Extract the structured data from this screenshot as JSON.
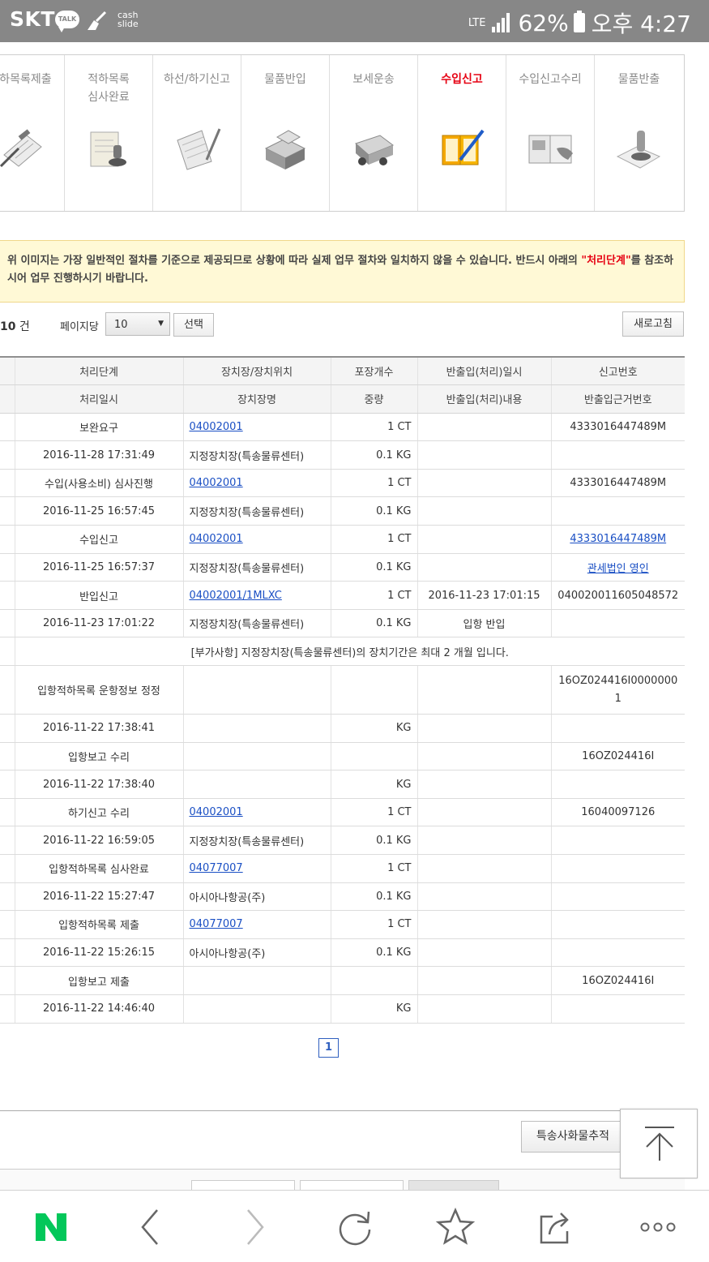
{
  "status_bar": {
    "carrier": "SKT",
    "talk_badge": "TALK",
    "cash_line1": "cash",
    "cash_line2": "slide",
    "lte": "LTE",
    "battery": "62%",
    "time": "오후 4:27"
  },
  "steps": [
    {
      "label": "적하목록제출",
      "icon": "clipboard-pen-icon",
      "active": false
    },
    {
      "label": "적하목록 심사완료",
      "icon": "document-stamp-icon",
      "active": false
    },
    {
      "label": "하선/하기신고",
      "icon": "notepad-pen-icon",
      "active": false
    },
    {
      "label": "물품반입",
      "icon": "cargo-box-icon",
      "active": false
    },
    {
      "label": "보세운송",
      "icon": "truck-icon",
      "active": false
    },
    {
      "label": "수입신고",
      "icon": "book-pen-icon",
      "active": true
    },
    {
      "label": "수입신고수리",
      "icon": "document-hand-icon",
      "active": false
    },
    {
      "label": "물품반출",
      "icon": "release-stamp-icon",
      "active": false
    }
  ],
  "notice": {
    "text_before": "위 이미지는 가장 일반적인 절차를 기준으로 제공되므로 상황에 따라 실제 업무 절차와 일치하지 않을 수 있습니다. 반드시 아래의 ",
    "highlight": "\"처리단계\"",
    "text_after": "를 참조하시어 업무 진행하시기 바랍니다."
  },
  "controls": {
    "count_value": "10",
    "count_unit": " 건",
    "per_page_label": "페이지당",
    "per_page_value": "10",
    "select_button": "선택",
    "refresh_button": "새로고침"
  },
  "table": {
    "header1": [
      "처리단계",
      "장치장/장치위치",
      "포장개수",
      "반출입(처리)일시",
      "신고번호"
    ],
    "header2": [
      "처리일시",
      "장치장명",
      "중량",
      "반출입(처리)내용",
      "반출입근거번호"
    ],
    "records": [
      {
        "stage": "보완요구",
        "code": "04002001",
        "pkg": "1 CT",
        "io_dt": "",
        "decl_no": "4333016447489M",
        "decl_link": false,
        "proc_dt": "2016-11-28 17:31:49",
        "place": "지정장치장(특송물류센터)",
        "weight": "0.1 KG",
        "io_desc": "",
        "basis": "",
        "basis_link": false
      },
      {
        "stage": "수입(사용소비) 심사진행",
        "code": "04002001",
        "pkg": "1 CT",
        "io_dt": "",
        "decl_no": "4333016447489M",
        "decl_link": false,
        "proc_dt": "2016-11-25 16:57:45",
        "place": "지정장치장(특송물류센터)",
        "weight": "0.1 KG",
        "io_desc": "",
        "basis": "",
        "basis_link": false
      },
      {
        "stage": "수입신고",
        "code": "04002001",
        "pkg": "1 CT",
        "io_dt": "",
        "decl_no": "4333016447489M",
        "decl_link": true,
        "proc_dt": "2016-11-25 16:57:37",
        "place": "지정장치장(특송물류센터)",
        "weight": "0.1 KG",
        "io_desc": "",
        "basis": "관세법인   영인",
        "basis_link": true
      },
      {
        "stage": "반입신고",
        "code": "04002001/1MLXC",
        "pkg": "1 CT",
        "io_dt": "2016-11-23 17:01:15",
        "decl_no": "040020011605048572",
        "decl_link": false,
        "proc_dt": "2016-11-23 17:01:22",
        "place": "지정장치장(특송물류센터)",
        "weight": "0.1 KG",
        "io_desc": "입항 반입",
        "basis": "",
        "basis_link": false
      },
      {
        "stage": "입항적하목록 운항정보 정정",
        "code": "",
        "pkg": "",
        "io_dt": "",
        "decl_no": "16OZ024416I00000001",
        "decl_link": false,
        "proc_dt": "2016-11-22 17:38:41",
        "place": "",
        "weight": "KG",
        "io_desc": "",
        "basis": "",
        "basis_link": false
      },
      {
        "stage": "입항보고 수리",
        "code": "",
        "pkg": "",
        "io_dt": "",
        "decl_no": "16OZ024416I",
        "decl_link": false,
        "proc_dt": "2016-11-22 17:38:40",
        "place": "",
        "weight": "KG",
        "io_desc": "",
        "basis": "",
        "basis_link": false
      },
      {
        "stage": "하기신고 수리",
        "code": "04002001",
        "pkg": "1 CT",
        "io_dt": "",
        "decl_no": "16040097126",
        "decl_link": false,
        "proc_dt": "2016-11-22 16:59:05",
        "place": "지정장치장(특송물류센터)",
        "weight": "0.1 KG",
        "io_desc": "",
        "basis": "",
        "basis_link": false
      },
      {
        "stage": "입항적하목록 심사완료",
        "code": "04077007",
        "pkg": "1 CT",
        "io_dt": "",
        "decl_no": "",
        "decl_link": false,
        "proc_dt": "2016-11-22 15:27:47",
        "place": "아시아나항공(주)",
        "weight": "0.1 KG",
        "io_desc": "",
        "basis": "",
        "basis_link": false
      },
      {
        "stage": "입항적하목록 제출",
        "code": "04077007",
        "pkg": "1 CT",
        "io_dt": "",
        "decl_no": "",
        "decl_link": false,
        "proc_dt": "2016-11-22 15:26:15",
        "place": "아시아나항공(주)",
        "weight": "0.1 KG",
        "io_desc": "",
        "basis": "",
        "basis_link": false
      },
      {
        "stage": "입항보고 제출",
        "code": "",
        "pkg": "",
        "io_dt": "",
        "decl_no": "16OZ024416I",
        "decl_link": false,
        "proc_dt": "2016-11-22 14:46:40",
        "place": "",
        "weight": "KG",
        "io_desc": "",
        "basis": "",
        "basis_link": false
      }
    ],
    "extra_note": "[부가사항] 지정장치장(특송물류센터)의 장치기간은 최대 2 개월 입니다."
  },
  "pagination": {
    "current": "1"
  },
  "bottom": {
    "track_button": "특송사화물추적"
  },
  "browser_bar": {
    "logo": "N"
  },
  "colors": {
    "active": "#e60012",
    "link": "#1a4fc4",
    "notice_bg": "#fff9d6",
    "naver_green": "#03c75a"
  }
}
